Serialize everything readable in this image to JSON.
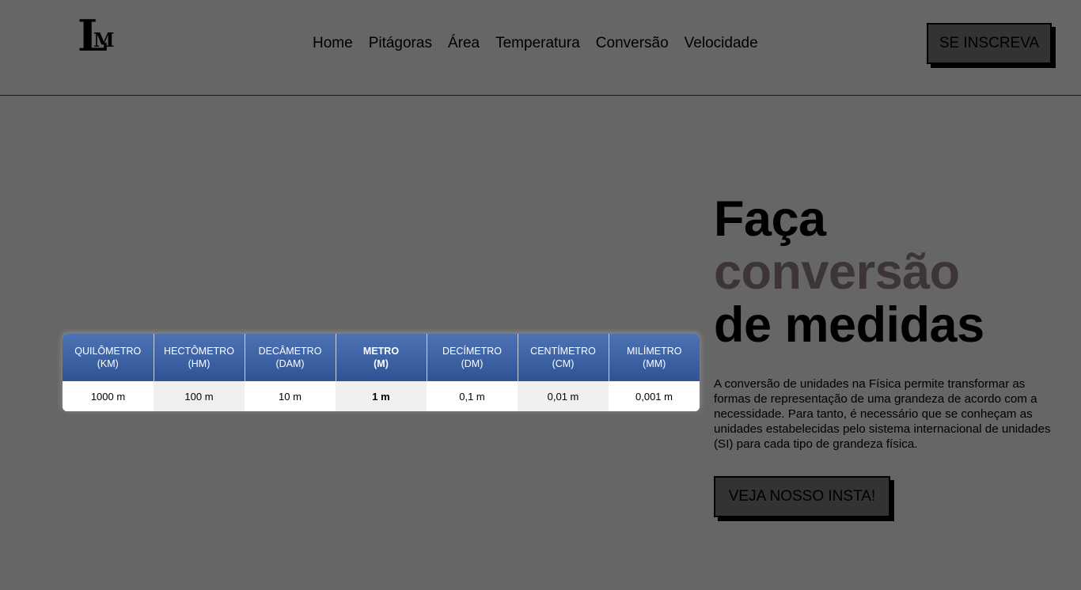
{
  "header": {
    "logo": {
      "big": "L",
      "small": "M"
    },
    "nav": [
      "Home",
      "Pitágoras",
      "Área",
      "Temperatura",
      "Conversão",
      "Velocidade"
    ],
    "signup_label": "SE INSCREVA"
  },
  "table": {
    "headers": [
      {
        "name": "QUILÔMETRO",
        "abbr": "(KM)"
      },
      {
        "name": "HECTÔMETRO",
        "abbr": "(HM)"
      },
      {
        "name": "DECÂMETRO",
        "abbr": "(DAM)"
      },
      {
        "name": "METRO",
        "abbr": "(M)"
      },
      {
        "name": "DECÍMETRO",
        "abbr": "(DM)"
      },
      {
        "name": "CENTÍMETRO",
        "abbr": "(CM)"
      },
      {
        "name": "MILÍMETRO",
        "abbr": "(MM)"
      }
    ],
    "values": [
      "1000 m",
      "100 m",
      "10 m",
      "1 m",
      "0,1 m",
      "0,01 m",
      "0,001 m"
    ]
  },
  "hero": {
    "line1": "Faça",
    "line2": "conversão",
    "line3": "de medidas",
    "description": "A conversão de unidades na Física permite transformar as formas de representação de uma grandeza de acordo com a necessidade. Para tanto, é necessário que se conheçam as unidades estabelecidas pelo sistema internacional de unidades (SI) para cada tipo de grandeza física.",
    "insta_label": "VEJA NOSSO INSTA!"
  },
  "colors": {
    "background": "#666666",
    "table_header": "#3a62a5",
    "accent_word": "#3d3535",
    "button": "#333333"
  }
}
